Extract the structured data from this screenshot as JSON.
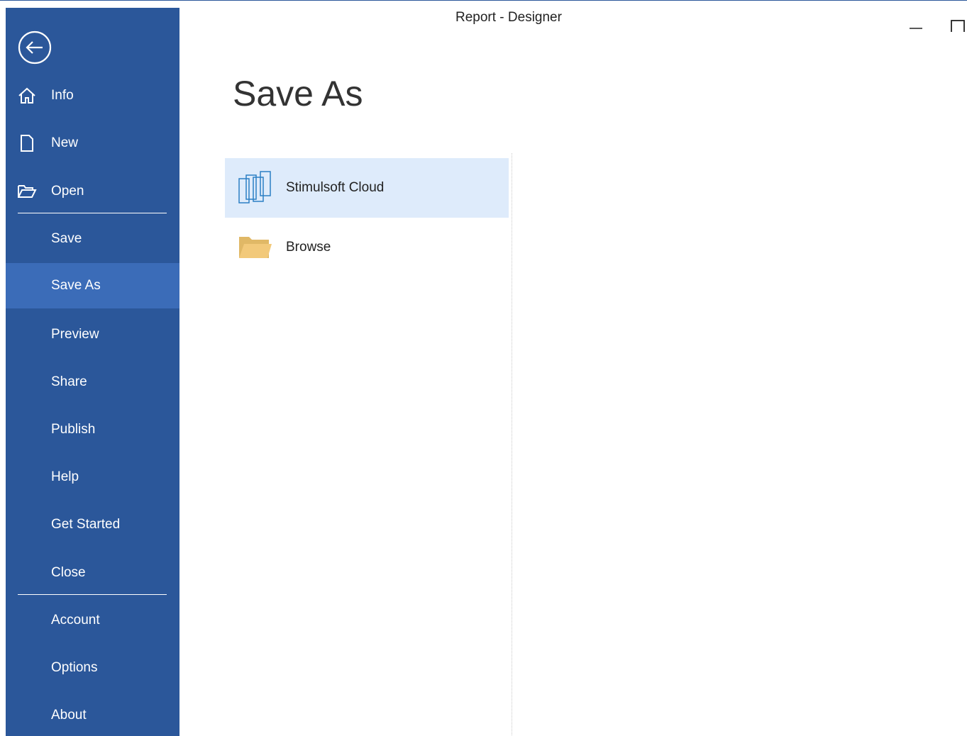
{
  "window": {
    "title": "Report - Designer"
  },
  "sidebar": {
    "items": [
      {
        "label": "Info",
        "icon": "home-icon"
      },
      {
        "label": "New",
        "icon": "new-document-icon"
      },
      {
        "label": "Open",
        "icon": "open-folder-icon"
      },
      {
        "label": "Save"
      },
      {
        "label": "Save As"
      },
      {
        "label": "Preview"
      },
      {
        "label": "Share"
      },
      {
        "label": "Publish"
      },
      {
        "label": "Help"
      },
      {
        "label": "Get Started"
      },
      {
        "label": "Close"
      },
      {
        "label": "Account"
      },
      {
        "label": "Options"
      },
      {
        "label": "About"
      }
    ],
    "active": "Save As"
  },
  "main": {
    "title": "Save As",
    "locations": [
      {
        "label": "Stimulsoft Cloud",
        "icon": "cloud-pages-icon",
        "selected": true
      },
      {
        "label": "Browse",
        "icon": "folder-icon",
        "selected": false
      }
    ]
  },
  "colors": {
    "sidebar_bg": "#2b579a",
    "sidebar_active": "#3b6cb8",
    "selected_location_bg": "#deebfb"
  }
}
